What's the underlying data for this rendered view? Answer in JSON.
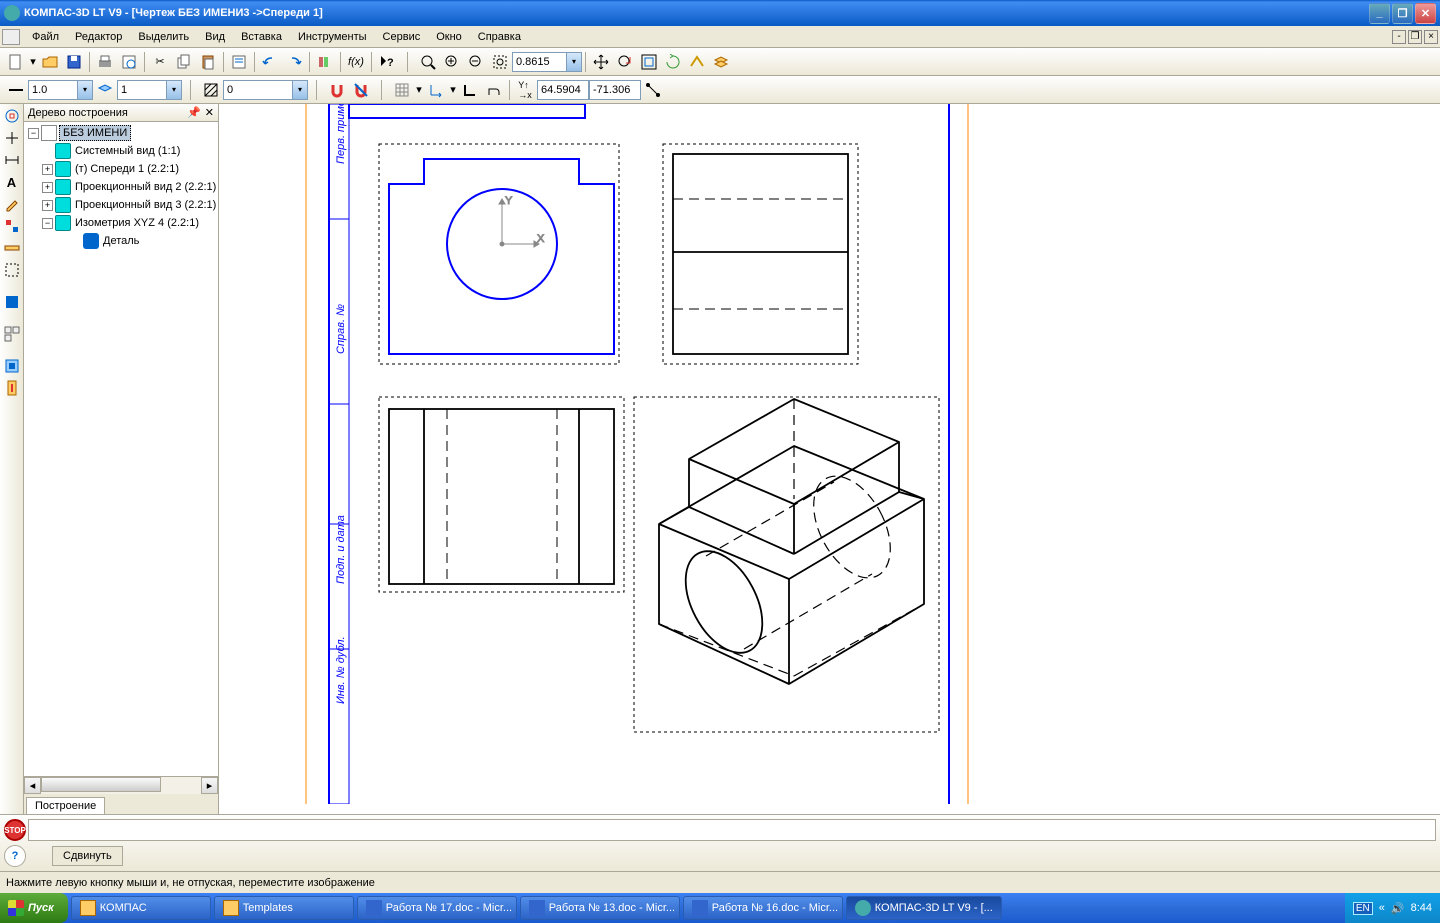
{
  "title": "КОМПАС-3D LT V9 - [Чертеж БЕЗ ИМЕНИ3 ->Спереди 1]",
  "menus": [
    "Файл",
    "Редактор",
    "Выделить",
    "Вид",
    "Вставка",
    "Инструменты",
    "Сервис",
    "Окно",
    "Справка"
  ],
  "zoom_value": "0.8615",
  "line_width": "1.0",
  "layer_value": "1",
  "step_value": "0",
  "coord_x": "64.5904",
  "coord_y": "-71.306",
  "tree": {
    "title": "Дерево построения",
    "root": "БЕЗ ИМЕНИ",
    "items": [
      "Системный вид (1:1)",
      "(т) Спереди 1 (2.2:1)",
      "Проекционный вид 2 (2.2:1)",
      "Проекционный вид 3 (2.2:1)",
      "Изометрия XYZ 4 (2.2:1)"
    ],
    "subitem": "Деталь",
    "tab": "Построение"
  },
  "cmd_tab": "Сдвинуть",
  "status": "Нажмите левую кнопку мыши и, не отпуская, переместите изображение",
  "taskbar": {
    "start": "Пуск",
    "tasks": [
      "КОМПАС",
      "Templates",
      "Работа № 17.doc - Micr...",
      "Работа № 13.doc - Micr...",
      "Работа № 16.doc - Micr...",
      "КОМПАС-3D LT V9 - [..."
    ],
    "lang": "EN",
    "time": "8:44"
  }
}
